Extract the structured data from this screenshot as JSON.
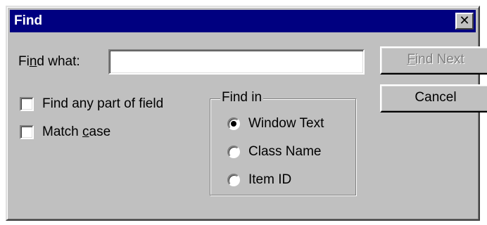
{
  "dialog": {
    "title": "Find",
    "close_glyph": "✕"
  },
  "find_what": {
    "label_pre": "Fi",
    "label_key": "n",
    "label_post": "d what:",
    "value": ""
  },
  "buttons": {
    "find_next": {
      "key": "F",
      "rest": "ind Next",
      "enabled": false
    },
    "cancel": {
      "label": "Cancel",
      "enabled": true
    }
  },
  "options": {
    "find_any_part": {
      "label": "Find any part of field",
      "checked": false
    },
    "match_case": {
      "label_pre": "Match ",
      "label_key": "c",
      "label_post": "ase",
      "checked": false
    }
  },
  "find_in": {
    "title": "Find in",
    "items": [
      {
        "label": "Window Text",
        "selected": true
      },
      {
        "label": "Class Name",
        "selected": false
      },
      {
        "label": "Item ID",
        "selected": false
      }
    ]
  }
}
